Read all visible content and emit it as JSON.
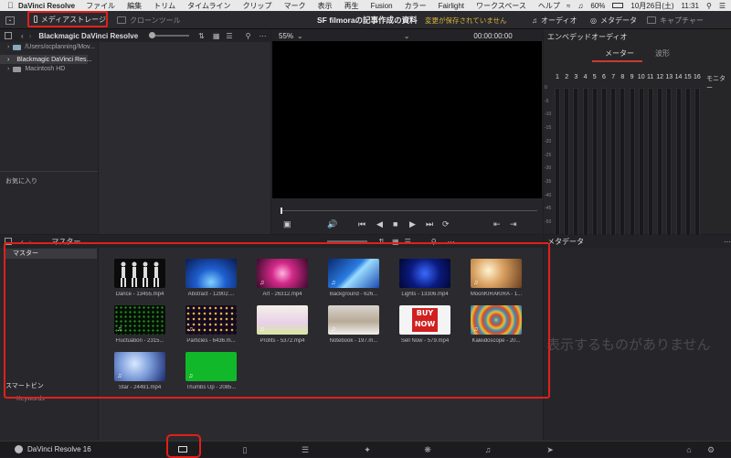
{
  "menubar": {
    "app": "DaVinci Resolve",
    "items": [
      "ファイル",
      "編集",
      "トリム",
      "タイムライン",
      "クリップ",
      "マーク",
      "表示",
      "再生",
      "Fusion",
      "カラー",
      "Fairlight",
      "ワークスペース",
      "ヘルプ"
    ],
    "battery": "60%",
    "date": "10月26日(土)",
    "time": "11:31"
  },
  "toolbar": {
    "media_storage": "メディアストレージ",
    "clone_tool": "クローンツール",
    "project_title": "SF filmoraの記事作成の資料",
    "unsaved": "変更が保存されていません",
    "audio": "オーディオ",
    "metadata": "メタデータ",
    "capture": "キャプチャー"
  },
  "storage": {
    "header": "Blackmagic DaVinci Resolve",
    "items": [
      "/Users/ocplanning/Mov...",
      "Blackmagic DaVinci Res...",
      "Macintosh HD"
    ],
    "favorites": "お気に入り"
  },
  "viewer": {
    "zoom": "55%",
    "timecode": "00:00:00:00"
  },
  "audio_panel": {
    "title": "エンベデッドオーディオ",
    "tab_meter": "メーター",
    "tab_wave": "波形",
    "channels": [
      "1",
      "2",
      "3",
      "4",
      "5",
      "6",
      "7",
      "8",
      "9",
      "10",
      "11",
      "12",
      "13",
      "14",
      "15",
      "16"
    ],
    "monitor": "モニター",
    "db_labels": [
      "0",
      "-5",
      "-10",
      "-15",
      "-20",
      "-25",
      "-30",
      "-35",
      "-40",
      "-45",
      "-50"
    ]
  },
  "pool": {
    "bar_title": "マスター",
    "bin": "マスター",
    "smart_bin": "スマートビン",
    "keywords": "Keywords",
    "metadata_title": "メタデータ",
    "empty": "表示するものがありません",
    "clips": [
      {
        "label": "Dance - 13455.mp4",
        "audio": false
      },
      {
        "label": "Abstract - 12902....",
        "audio": false
      },
      {
        "label": "Art - 26312.mp4",
        "audio": true
      },
      {
        "label": "Background - 626...",
        "audio": true
      },
      {
        "label": "Lights - 13306.mp4",
        "audio": false
      },
      {
        "label": "MoonKIRAKIRA - 1...",
        "audio": true
      },
      {
        "label": "Fluctuation - 2315...",
        "audio": true
      },
      {
        "label": "Particles - 6436.m...",
        "audio": true
      },
      {
        "label": "Profits - 5372.mp4",
        "audio": true
      },
      {
        "label": "Notebook - 197.m...",
        "audio": true
      },
      {
        "label": "Sell Now - 579.mp4",
        "audio": false
      },
      {
        "label": "Kaleidoscope - 20...",
        "audio": true
      },
      {
        "label": "Star - 24491.mp4",
        "audio": true
      },
      {
        "label": "Thumbs Up - 2085...",
        "audio": true
      }
    ],
    "sell_now_text": "BUY NOW"
  },
  "bottom": {
    "app_label": "DaVinci Resolve 16"
  }
}
